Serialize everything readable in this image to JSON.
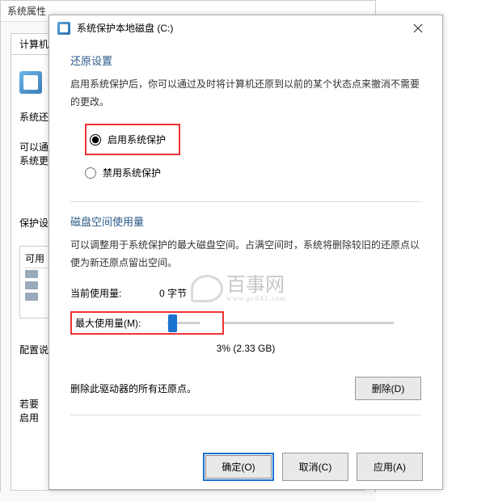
{
  "back_window": {
    "title": "系统属性",
    "tab1": "计算机名",
    "restore_heading": "系统还原",
    "restore_hint1": "可以通",
    "restore_hint2": "系统更",
    "protect_heading": "保护设",
    "col1": "可用",
    "config_heading": "配置说",
    "bottom_hint1": "若要",
    "bottom_hint2": "启用"
  },
  "front_window": {
    "title": "系统保护本地磁盘 (C:)"
  },
  "restore": {
    "heading": "还原设置",
    "description": "启用系统保护后，你可以通过及时将计算机还原到以前的某个状态点来撤消不需要的更改。",
    "option_enable": "启用系统保护",
    "option_disable": "禁用系统保护",
    "selected": "enable"
  },
  "disk": {
    "heading": "磁盘空间使用量",
    "description": "可以调整用于系统保护的最大磁盘空间。占满空间时，系统将删除较旧的还原点以便为新还原点留出空间。",
    "current_label": "当前使用量:",
    "current_value": "0 字节",
    "max_label": "最大使用量(M):",
    "slider_percent": 3,
    "slider_display": "3% (2.33 GB)"
  },
  "delete": {
    "text": "删除此驱动器的所有还原点。",
    "button": "删除(D)"
  },
  "buttons": {
    "ok": "确定(O)",
    "cancel": "取消(C)",
    "apply": "应用(A)"
  },
  "watermark": {
    "main": "百事网",
    "sub": "www.pc841.com"
  }
}
